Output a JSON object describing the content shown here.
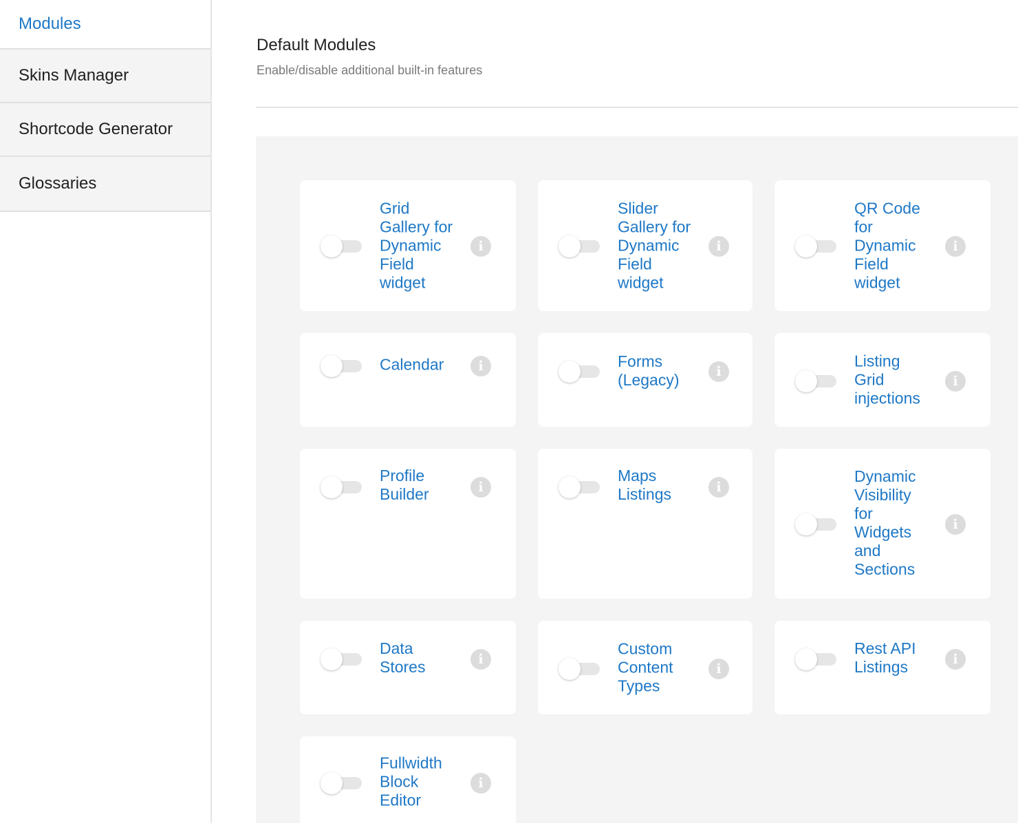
{
  "sidebar": {
    "items": [
      {
        "label": "Modules",
        "active": true
      },
      {
        "label": "Skins Manager",
        "active": false
      },
      {
        "label": "Shortcode Generator",
        "active": false
      },
      {
        "label": "Glossaries",
        "active": false
      }
    ]
  },
  "header": {
    "title": "Default Modules",
    "subtitle": "Enable/disable additional built-in features"
  },
  "modules": [
    {
      "label": "Grid Gallery for Dynamic Field widget",
      "enabled": false,
      "icon": "info-icon"
    },
    {
      "label": "Slider Gallery for Dynamic Field widget",
      "enabled": false,
      "icon": "info-icon"
    },
    {
      "label": "QR Code for Dynamic Field widget",
      "enabled": false,
      "icon": "info-icon"
    },
    {
      "label": "Calendar",
      "enabled": false,
      "icon": "info-icon"
    },
    {
      "label": "Forms (Legacy)",
      "enabled": false,
      "icon": "info-icon"
    },
    {
      "label": "Listing Grid injections",
      "enabled": false,
      "icon": "info-icon"
    },
    {
      "label": "Profile Builder",
      "enabled": false,
      "icon": "info-icon"
    },
    {
      "label": "Maps Listings",
      "enabled": false,
      "icon": "info-icon"
    },
    {
      "label": "Dynamic Visibility for Widgets and Sections",
      "enabled": false,
      "icon": "info-icon"
    },
    {
      "label": "Data Stores",
      "enabled": false,
      "icon": "info-icon"
    },
    {
      "label": "Custom Content Types",
      "enabled": false,
      "icon": "info-icon"
    },
    {
      "label": "Rest API Listings",
      "enabled": false,
      "icon": "info-icon"
    },
    {
      "label": "Fullwidth Block Editor",
      "enabled": false,
      "icon": "info-icon"
    }
  ],
  "colors": {
    "accent": "#1e78c6",
    "panel_bg": "#f4f4f4",
    "toggle_off": "#e6e6e6",
    "info_icon": "#dcdcdc"
  }
}
